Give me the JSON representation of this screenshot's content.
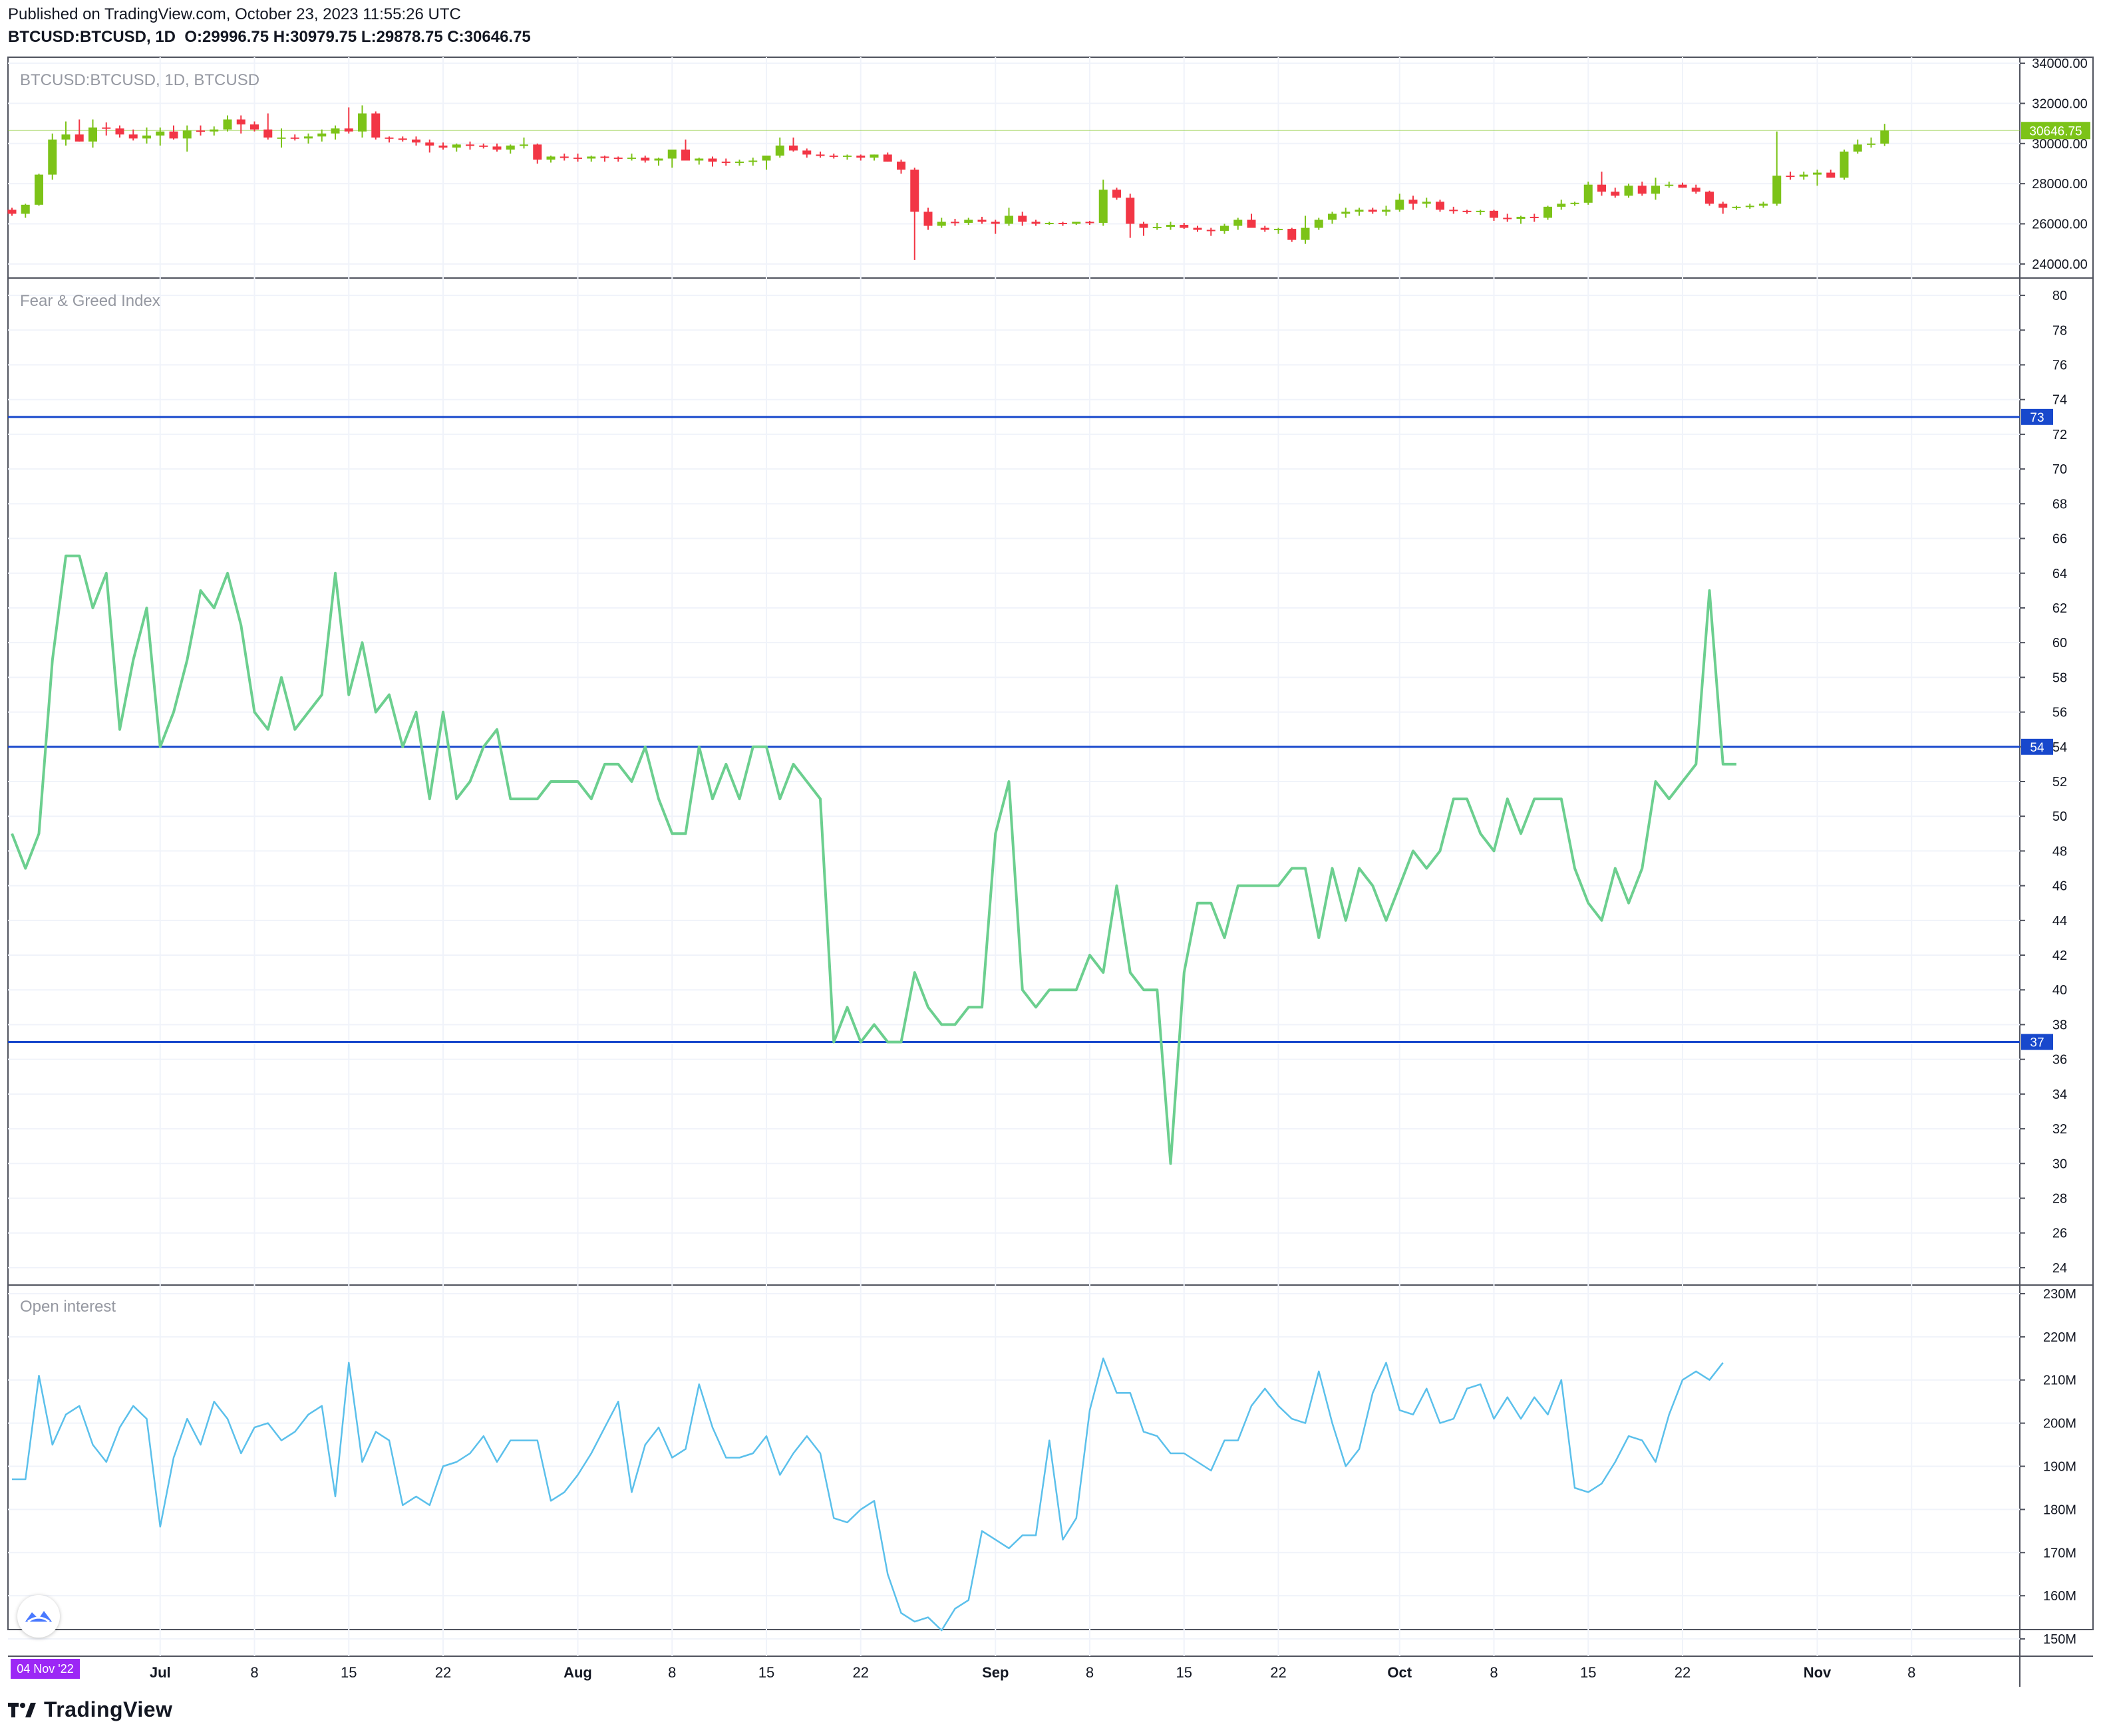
{
  "header": {
    "published": "Published on TradingView.com, October 23, 2023 11:55:26 UTC",
    "symbol": "BTCUSD:BTCUSD, 1D",
    "o_label": "O:",
    "o_value": "29996.75",
    "h_label": "H:",
    "h_value": "30979.75",
    "l_label": "L:",
    "l_value": "29878.75",
    "c_label": "C:",
    "c_value": "30646.75"
  },
  "footer": {
    "brand": "TradingView",
    "date_badge": "04 Nov '22"
  },
  "colors": {
    "up": "#7cc318",
    "down": "#f23645",
    "fg_line": "#6ccf8f",
    "oi_line": "#5bc0eb",
    "level": "#1848cc",
    "badge": "#9c27f5"
  },
  "chart_data": [
    {
      "type": "candlestick",
      "title": "BTCUSD:BTCUSD, 1D, BTCUSD",
      "last_value_label": "30646.75",
      "y_ticks": [
        24000,
        26000,
        28000,
        30000,
        32000,
        34000
      ],
      "y_tick_labels": [
        "24000.00",
        "26000.00",
        "28000.00",
        "30000.00",
        "32000.00",
        "34000.00"
      ],
      "ylim": [
        23300,
        34300
      ],
      "start": "2023-06-20",
      "ohlc": [
        [
          26700,
          26800,
          26400,
          26500
        ],
        [
          26500,
          27000,
          26300,
          26950
        ],
        [
          26950,
          28500,
          26900,
          28450
        ],
        [
          28450,
          30500,
          28200,
          30200
        ],
        [
          30200,
          31100,
          29900,
          30450
        ],
        [
          30450,
          31200,
          30100,
          30100
        ],
        [
          30100,
          31200,
          29800,
          30800
        ],
        [
          30800,
          31050,
          30400,
          30750
        ],
        [
          30750,
          30900,
          30300,
          30450
        ],
        [
          30450,
          30700,
          30150,
          30250
        ],
        [
          30250,
          30800,
          30000,
          30400
        ],
        [
          30400,
          30800,
          29900,
          30600
        ],
        [
          30600,
          30900,
          30200,
          30250
        ],
        [
          30250,
          30900,
          29600,
          30650
        ],
        [
          30650,
          30900,
          30400,
          30600
        ],
        [
          30600,
          30850,
          30400,
          30700
        ],
        [
          30700,
          31400,
          30600,
          31200
        ],
        [
          31200,
          31400,
          30500,
          30950
        ],
        [
          30950,
          31100,
          30600,
          30700
        ],
        [
          30700,
          31500,
          30200,
          30300
        ],
        [
          30300,
          30750,
          29800,
          30300
        ],
        [
          30300,
          30450,
          30150,
          30250
        ],
        [
          30250,
          30500,
          30000,
          30350
        ],
        [
          30350,
          30700,
          30100,
          30500
        ],
        [
          30500,
          30900,
          30200,
          30750
        ],
        [
          30750,
          31800,
          30500,
          30600
        ],
        [
          30600,
          31900,
          30300,
          31500
        ],
        [
          31500,
          31600,
          30200,
          30300
        ],
        [
          30300,
          30350,
          30050,
          30250
        ],
        [
          30250,
          30350,
          30100,
          30200
        ],
        [
          30200,
          30350,
          29900,
          30050
        ],
        [
          30050,
          30200,
          29550,
          29900
        ],
        [
          29900,
          30050,
          29700,
          29800
        ],
        [
          29800,
          30000,
          29600,
          29950
        ],
        [
          29950,
          30100,
          29700,
          29900
        ],
        [
          29900,
          30000,
          29750,
          29850
        ],
        [
          29850,
          30000,
          29600,
          29700
        ],
        [
          29700,
          29950,
          29500,
          29900
        ],
        [
          29900,
          30300,
          29750,
          29950
        ],
        [
          29950,
          30000,
          29000,
          29200
        ],
        [
          29200,
          29400,
          29050,
          29350
        ],
        [
          29350,
          29500,
          29150,
          29300
        ],
        [
          29300,
          29500,
          29100,
          29250
        ],
        [
          29250,
          29400,
          29100,
          29350
        ],
        [
          29350,
          29400,
          29100,
          29300
        ],
        [
          29300,
          29350,
          29100,
          29250
        ],
        [
          29250,
          29500,
          29150,
          29300
        ],
        [
          29300,
          29400,
          29050,
          29150
        ],
        [
          29150,
          29300,
          28900,
          29250
        ],
        [
          29250,
          29500,
          28800,
          29700
        ],
        [
          29700,
          30200,
          29200,
          29150
        ],
        [
          29150,
          29300,
          28950,
          29250
        ],
        [
          29250,
          29350,
          28850,
          29100
        ],
        [
          29100,
          29250,
          28900,
          29050
        ],
        [
          29050,
          29200,
          28900,
          29100
        ],
        [
          29100,
          29300,
          28900,
          29150
        ],
        [
          29150,
          29300,
          28700,
          29400
        ],
        [
          29400,
          30300,
          29300,
          29900
        ],
        [
          29900,
          30300,
          29600,
          29650
        ],
        [
          29650,
          29750,
          29300,
          29450
        ],
        [
          29450,
          29600,
          29300,
          29400
        ],
        [
          29400,
          29500,
          29250,
          29350
        ],
        [
          29350,
          29450,
          29200,
          29400
        ],
        [
          29400,
          29450,
          29150,
          29300
        ],
        [
          29300,
          29450,
          29150,
          29450
        ],
        [
          29450,
          29550,
          29100,
          29100
        ],
        [
          29100,
          29200,
          28500,
          28700
        ],
        [
          28700,
          28800,
          24200,
          26600
        ],
        [
          26600,
          26800,
          25700,
          25900
        ],
        [
          25900,
          26300,
          25800,
          26100
        ],
        [
          26100,
          26250,
          25900,
          26050
        ],
        [
          26050,
          26300,
          25950,
          26200
        ],
        [
          26200,
          26350,
          26000,
          26100
        ],
        [
          26100,
          26200,
          25500,
          26000
        ],
        [
          26000,
          26800,
          25900,
          26400
        ],
        [
          26400,
          26600,
          25900,
          26100
        ],
        [
          26100,
          26200,
          25900,
          26000
        ],
        [
          26000,
          26100,
          25950,
          26050
        ],
        [
          26050,
          26100,
          25900,
          26000
        ],
        [
          26000,
          26100,
          25950,
          26100
        ],
        [
          26100,
          26150,
          25950,
          26050
        ],
        [
          26050,
          28200,
          25900,
          27700
        ],
        [
          27700,
          27800,
          27200,
          27300
        ],
        [
          27300,
          27500,
          25300,
          26000
        ],
        [
          26000,
          26100,
          25400,
          25800
        ],
        [
          25800,
          26050,
          25700,
          25850
        ],
        [
          25850,
          26100,
          25700,
          25950
        ],
        [
          25950,
          26050,
          25750,
          25800
        ],
        [
          25800,
          25900,
          25600,
          25700
        ],
        [
          25700,
          25800,
          25400,
          25650
        ],
        [
          25650,
          26000,
          25500,
          25900
        ],
        [
          25900,
          26300,
          25700,
          26200
        ],
        [
          26200,
          26500,
          25900,
          25800
        ],
        [
          25800,
          25900,
          25600,
          25700
        ],
        [
          25700,
          25800,
          25500,
          25750
        ],
        [
          25750,
          25800,
          25100,
          25200
        ],
        [
          25200,
          26400,
          25000,
          25800
        ],
        [
          25800,
          26300,
          25700,
          26200
        ],
        [
          26200,
          26600,
          26000,
          26500
        ],
        [
          26500,
          26800,
          26300,
          26600
        ],
        [
          26600,
          26800,
          26400,
          26700
        ],
        [
          26700,
          26800,
          26500,
          26600
        ],
        [
          26600,
          26900,
          26400,
          26700
        ],
        [
          26700,
          27500,
          26600,
          27200
        ],
        [
          27200,
          27400,
          26700,
          27000
        ],
        [
          27000,
          27300,
          26800,
          27100
        ],
        [
          27100,
          27200,
          26600,
          26700
        ],
        [
          26700,
          26850,
          26500,
          26650
        ],
        [
          26650,
          26700,
          26500,
          26600
        ],
        [
          26600,
          26700,
          26450,
          26650
        ],
        [
          26650,
          26700,
          26150,
          26300
        ],
        [
          26300,
          26500,
          26100,
          26250
        ],
        [
          26250,
          26400,
          26000,
          26350
        ],
        [
          26350,
          26500,
          26100,
          26300
        ],
        [
          26300,
          26900,
          26200,
          26850
        ],
        [
          26850,
          27200,
          26700,
          27000
        ],
        [
          27000,
          27100,
          26900,
          27050
        ],
        [
          27050,
          28100,
          26950,
          27950
        ],
        [
          27950,
          28600,
          27400,
          27600
        ],
        [
          27600,
          27800,
          27300,
          27400
        ],
        [
          27400,
          28000,
          27300,
          27900
        ],
        [
          27900,
          28100,
          27400,
          27500
        ],
        [
          27500,
          28300,
          27200,
          27900
        ],
        [
          27900,
          28100,
          27800,
          27950
        ],
        [
          27950,
          28050,
          27800,
          27800
        ],
        [
          27800,
          27950,
          27500,
          27600
        ],
        [
          27600,
          27650,
          26900,
          27000
        ],
        [
          27000,
          27100,
          26500,
          26800
        ],
        [
          26800,
          26900,
          26700,
          26850
        ],
        [
          26850,
          27000,
          26750,
          26900
        ],
        [
          26900,
          27100,
          26800,
          27000
        ],
        [
          27000,
          30600,
          26900,
          28400
        ],
        [
          28400,
          28600,
          28200,
          28350
        ],
        [
          28350,
          28600,
          28200,
          28450
        ],
        [
          28450,
          28700,
          27900,
          28550
        ],
        [
          28550,
          28700,
          28300,
          28300
        ],
        [
          28300,
          29700,
          28200,
          29600
        ],
        [
          29600,
          30200,
          29500,
          29950
        ],
        [
          29950,
          30300,
          29800,
          30000
        ],
        [
          29996.75,
          30979.75,
          29878.75,
          30646.75
        ]
      ]
    },
    {
      "type": "line",
      "title": "Fear & Greed Index",
      "y_ticks": [
        24,
        26,
        28,
        30,
        32,
        34,
        36,
        38,
        40,
        42,
        44,
        46,
        48,
        50,
        52,
        54,
        56,
        58,
        60,
        62,
        64,
        66,
        68,
        70,
        72,
        74,
        76,
        78,
        80
      ],
      "ylim": [
        23,
        81
      ],
      "levels": [
        73,
        54,
        37
      ],
      "level_labels": [
        "73",
        "54",
        "37"
      ],
      "values": [
        49,
        47,
        49,
        59,
        65,
        65,
        62,
        64,
        55,
        59,
        62,
        54,
        56,
        59,
        63,
        62,
        64,
        61,
        56,
        55,
        58,
        55,
        56,
        57,
        64,
        57,
        60,
        56,
        57,
        54,
        56,
        51,
        56,
        51,
        52,
        54,
        55,
        51,
        51,
        51,
        52,
        52,
        52,
        51,
        53,
        53,
        52,
        54,
        51,
        49,
        49,
        54,
        51,
        53,
        51,
        54,
        54,
        51,
        53,
        52,
        51,
        37,
        39,
        37,
        38,
        37,
        37,
        41,
        39,
        38,
        38,
        39,
        39,
        49,
        52,
        40,
        39,
        40,
        40,
        40,
        42,
        41,
        46,
        41,
        40,
        40,
        30,
        41,
        45,
        45,
        43,
        46,
        46,
        46,
        46,
        47,
        47,
        43,
        47,
        44,
        47,
        46,
        44,
        46,
        48,
        47,
        48,
        51,
        51,
        49,
        48,
        51,
        49,
        51,
        51,
        51,
        47,
        45,
        44,
        47,
        45,
        47,
        52,
        51,
        52,
        53,
        63,
        53,
        53
      ]
    },
    {
      "type": "line",
      "title": "Open interest",
      "y_ticks": [
        150,
        160,
        170,
        180,
        190,
        200,
        210,
        220,
        230
      ],
      "y_tick_labels": [
        "150M",
        "160M",
        "170M",
        "180M",
        "190M",
        "200M",
        "210M",
        "220M",
        "230M"
      ],
      "ylim": [
        146,
        232
      ],
      "x_tick_labels": [
        "Jul",
        "8",
        "15",
        "22",
        "Aug",
        "8",
        "15",
        "22",
        "Sep",
        "8",
        "15",
        "22",
        "Oct",
        "8",
        "15",
        "22",
        "Nov",
        "8"
      ],
      "values": [
        187,
        187,
        211,
        195,
        202,
        204,
        195,
        191,
        199,
        204,
        201,
        176,
        192,
        201,
        195,
        205,
        201,
        193,
        199,
        200,
        196,
        198,
        202,
        204,
        183,
        214,
        191,
        198,
        196,
        181,
        183,
        181,
        190,
        191,
        193,
        197,
        191,
        196,
        196,
        196,
        182,
        184,
        188,
        193,
        199,
        205,
        184,
        195,
        199,
        192,
        194,
        209,
        199,
        192,
        192,
        193,
        197,
        188,
        193,
        197,
        193,
        178,
        177,
        180,
        182,
        165,
        156,
        154,
        155,
        152,
        157,
        159,
        175,
        173,
        171,
        174,
        174,
        196,
        173,
        178,
        203,
        215,
        207,
        207,
        198,
        197,
        193,
        193,
        191,
        189,
        196,
        196,
        204,
        208,
        204,
        201,
        200,
        212,
        200,
        190,
        194,
        207,
        214,
        203,
        202,
        208,
        200,
        201,
        208,
        209,
        201,
        206,
        201,
        206,
        202,
        210,
        185,
        184,
        186,
        191,
        197,
        196,
        191,
        202,
        210,
        212,
        210,
        214
      ]
    }
  ]
}
